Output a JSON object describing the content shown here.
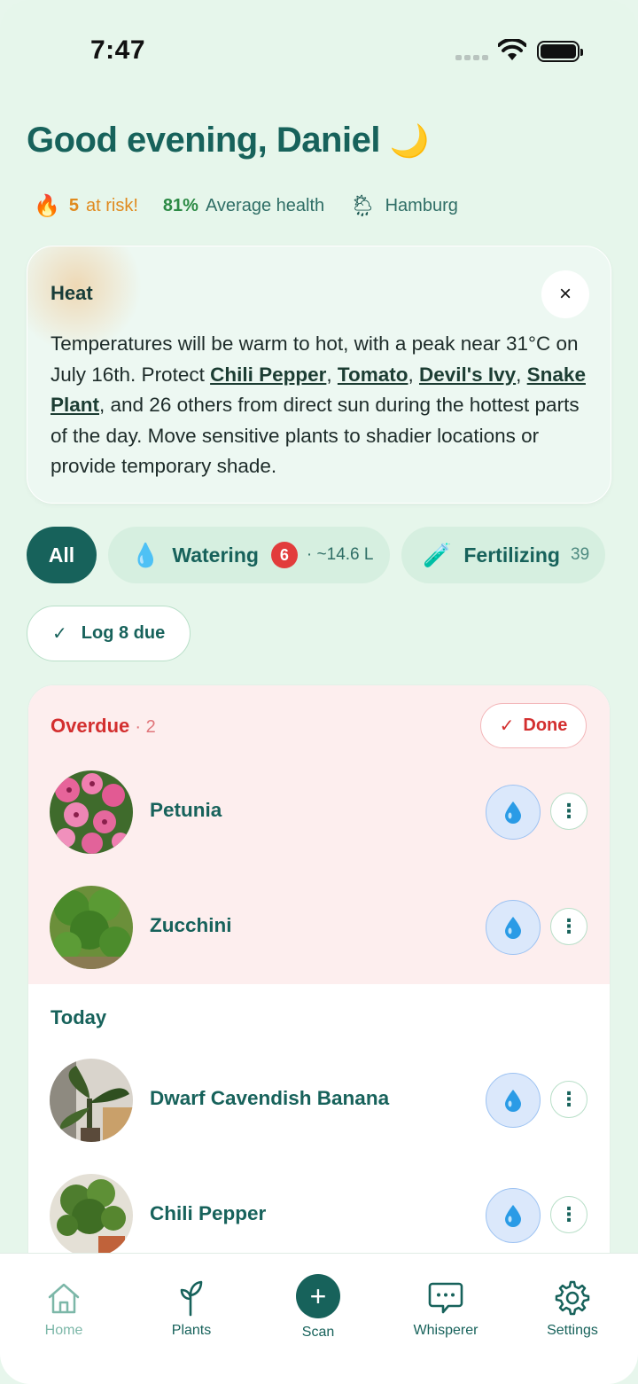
{
  "status_bar": {
    "time": "7:47"
  },
  "greeting": {
    "text": "Good evening, Daniel",
    "emoji": "🌙"
  },
  "stats": {
    "risk_icon": "🔥",
    "risk_count": "5",
    "risk_label": "at risk!",
    "health_value": "81%",
    "health_label": "Average health",
    "weather_icon": "🌦",
    "city": "Hamburg"
  },
  "alert": {
    "title": "Heat",
    "close_icon": "×",
    "text_1": "Temperatures will be warm to hot, with a peak near 31°C on July 16th. Protect ",
    "plant_1": "Chili Pepper",
    "sep_1": ", ",
    "plant_2": "Tomato",
    "sep_2": ", ",
    "plant_3": "Devil's Ivy",
    "sep_3": ", ",
    "plant_4": "Snake Plant",
    "text_2": ", and 26 others from direct sun during the hottest parts of the day. Move sensitive plants to shadier locations or provide temporary shade."
  },
  "filters": {
    "all_label": "All",
    "watering_icon": "💧",
    "watering_label": "Watering",
    "watering_badge": "6",
    "watering_sub": "· ~14.6 L",
    "fertilizing_icon": "🧪",
    "fertilizing_label": "Fertilizing",
    "fertilizing_count": "39"
  },
  "log_button": {
    "check": "✓",
    "label": "Log 8 due"
  },
  "overdue": {
    "title": "Overdue",
    "count": "· 2",
    "done_check": "✓",
    "done_label": "Done",
    "items": [
      {
        "name": "Petunia"
      },
      {
        "name": "Zucchini"
      }
    ]
  },
  "today": {
    "title": "Today",
    "items": [
      {
        "name": "Dwarf Cavendish Banana"
      },
      {
        "name": "Chili Pepper"
      }
    ]
  },
  "tabbar": {
    "home": "Home",
    "plants": "Plants",
    "scan": "Scan",
    "scan_icon": "+",
    "whisperer": "Whisperer",
    "settings": "Settings"
  },
  "colors": {
    "primary": "#17625b",
    "background": "#e6f6eb",
    "overdue_bg": "#fdeeee",
    "danger": "#d32f2f",
    "warning": "#e08a1e",
    "water_blue": "#2a9be6"
  }
}
